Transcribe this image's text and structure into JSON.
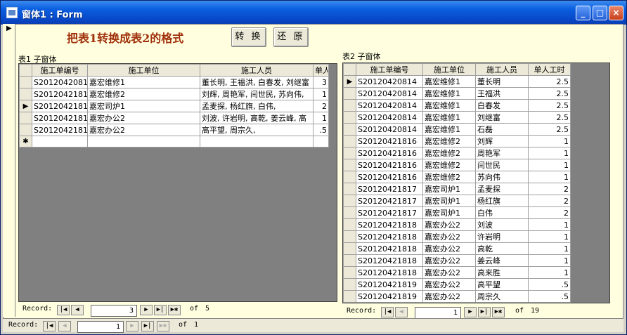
{
  "window": {
    "title": "窗体1 : Form",
    "minimize": "_",
    "maximize": "□",
    "close": "×"
  },
  "form": {
    "heading": "把表1转换成表2的格式",
    "convert_label": "转 换",
    "restore_label": "还 原",
    "record_marker": "▶"
  },
  "sub1": {
    "label": "表1 子窗体",
    "columns": [
      "施工单编号",
      "施工单位",
      "施工人员",
      "单人"
    ],
    "rows": [
      {
        "sel": "",
        "no": "S20120420814",
        "unit": "嘉宏维修1",
        "staff": "董长明, 王福洪, 白春发, 刘继富",
        "hours": "3"
      },
      {
        "sel": "",
        "no": "S20120421816",
        "unit": "嘉宏维修2",
        "staff": "刘辉, 周艳军, 闫世民, 苏向伟,",
        "hours": "1"
      },
      {
        "sel": "▶",
        "no": "S20120421817",
        "unit": "嘉宏司炉1",
        "staff": "孟麦探, 杨红旗, 白伟,",
        "hours": "2"
      },
      {
        "sel": "",
        "no": "S20120421818",
        "unit": "嘉宏办公2",
        "staff": "刘波, 许岩明, 高乾, 姜云峰, 高",
        "hours": "1"
      },
      {
        "sel": "",
        "no": "S20120421819",
        "unit": "嘉宏办公2",
        "staff": "高平望, 周宗久,",
        "hours": ".5"
      }
    ],
    "new_row": "✱",
    "nav": {
      "record_label": "Record:",
      "current": "3",
      "of_label": "of",
      "total": "5"
    }
  },
  "sub2": {
    "label": "表2 子窗体",
    "columns": [
      "施工单编号",
      "施工单位",
      "施工人员",
      "单人工时"
    ],
    "rows": [
      [
        "S20120420814",
        "嘉宏维修1",
        "董长明",
        "2.5"
      ],
      [
        "S20120420814",
        "嘉宏维修1",
        "王福洪",
        "2.5"
      ],
      [
        "S20120420814",
        "嘉宏维修1",
        "白春发",
        "2.5"
      ],
      [
        "S20120420814",
        "嘉宏维修1",
        "刘继富",
        "2.5"
      ],
      [
        "S20120420814",
        "嘉宏维修1",
        "石磊",
        "2.5"
      ],
      [
        "S20120421816",
        "嘉宏维修2",
        "刘辉",
        "1"
      ],
      [
        "S20120421816",
        "嘉宏维修2",
        "周艳军",
        "1"
      ],
      [
        "S20120421816",
        "嘉宏维修2",
        "闫世民",
        "1"
      ],
      [
        "S20120421816",
        "嘉宏维修2",
        "苏向伟",
        "1"
      ],
      [
        "S20120421817",
        "嘉宏司炉1",
        "孟麦探",
        "2"
      ],
      [
        "S20120421817",
        "嘉宏司炉1",
        "杨红旗",
        "2"
      ],
      [
        "S20120421817",
        "嘉宏司炉1",
        "白伟",
        "2"
      ],
      [
        "S20120421818",
        "嘉宏办公2",
        "刘波",
        "1"
      ],
      [
        "S20120421818",
        "嘉宏办公2",
        "许岩明",
        "1"
      ],
      [
        "S20120421818",
        "嘉宏办公2",
        "高乾",
        "1"
      ],
      [
        "S20120421818",
        "嘉宏办公2",
        "姜云峰",
        "1"
      ],
      [
        "S20120421818",
        "嘉宏办公2",
        "高来胜",
        "1"
      ],
      [
        "S20120421819",
        "嘉宏办公2",
        "高平望",
        ".5"
      ],
      [
        "S20120421819",
        "嘉宏办公2",
        "周宗久",
        ".5"
      ]
    ],
    "new_row": "✱",
    "nav": {
      "record_label": "Record:",
      "current": "1",
      "of_label": "of",
      "total": "19"
    }
  },
  "main_nav": {
    "record_label": "Record:",
    "current": "1",
    "of_label": "of",
    "total": "1"
  },
  "nav_icons": {
    "first": "|◀",
    "prev": "◀",
    "next": "▶",
    "last": "▶|",
    "new": "▶✱"
  }
}
